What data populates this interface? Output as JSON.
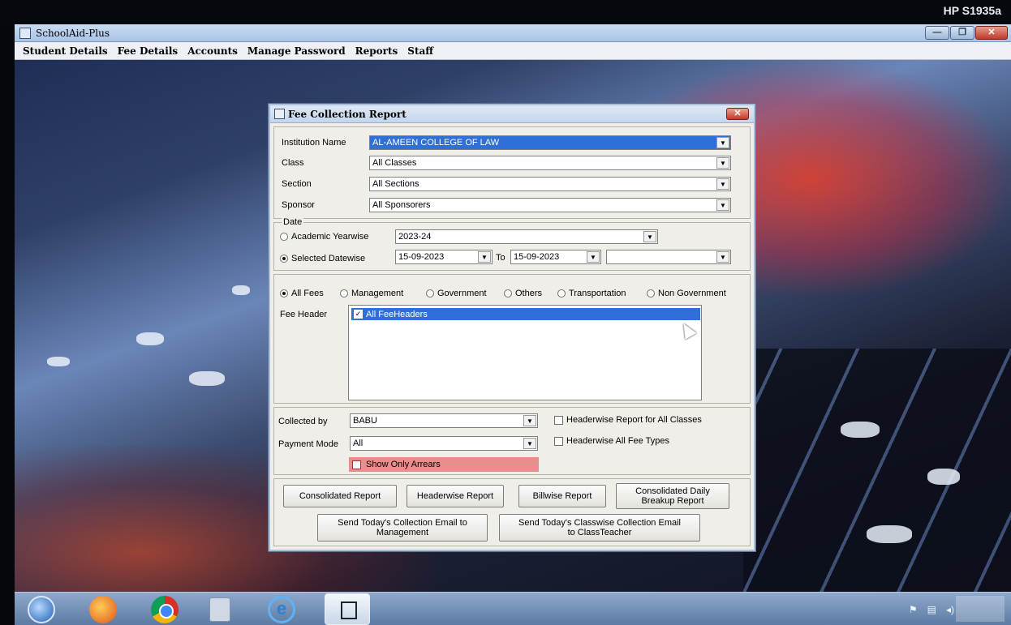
{
  "monitor": {
    "brand": "HP S1935a"
  },
  "app": {
    "title": "SchoolAid-Plus",
    "menu": [
      "Student Details",
      "Fee Details",
      "Accounts",
      "Manage Password",
      "Reports",
      "Staff"
    ]
  },
  "dialog": {
    "title": "Fee Collection Report",
    "institution": {
      "label": "Institution Name",
      "value": "AL-AMEEN COLLEGE OF LAW"
    },
    "class": {
      "label": "Class",
      "value": "All Classes"
    },
    "section": {
      "label": "Section",
      "value": "All Sections"
    },
    "sponsor": {
      "label": "Sponsor",
      "value": "All Sponsorers"
    },
    "date": {
      "group_label": "Date",
      "academic_label": "Academic Yearwise",
      "academic_value": "2023-24",
      "selected_label": "Selected Datewise",
      "from": "15-09-2023",
      "to_label": "To",
      "to": "15-09-2023",
      "extra_value": ""
    },
    "fee_types": {
      "all": "All Fees",
      "management": "Management",
      "government": "Government",
      "others": "Others",
      "transportation": "Transportation",
      "non_government": "Non Government",
      "selected": "All Fees"
    },
    "fee_header": {
      "label": "Fee Header",
      "item": "All FeeHeaders",
      "checked": true
    },
    "collected_by": {
      "label": "Collected by",
      "value": "BABU"
    },
    "payment_mode": {
      "label": "Payment Mode",
      "value": "All"
    },
    "headerwise_all_classes": "Headerwise Report for All Classes",
    "headerwise_all_fee_types": "Headerwise All Fee Types",
    "show_only_arrears": "Show Only Arrears",
    "buttons": {
      "consolidated": "Consolidated Report",
      "headerwise": "Headerwise Report",
      "billwise": "Billwise Report",
      "daily_breakup_1": "Consolidated Daily",
      "daily_breakup_2": "Breakup Report",
      "email_mgmt_1": "Send Today's Collection Email to",
      "email_mgmt_2": "Management",
      "email_class_1": "Send Today's Classwise Collection Email",
      "email_class_2": "to ClassTeacher"
    }
  },
  "colors": {
    "selection": "#2f6fd8",
    "arrears_bg": "#e98d8d",
    "dialog_bg": "#efeee9"
  }
}
